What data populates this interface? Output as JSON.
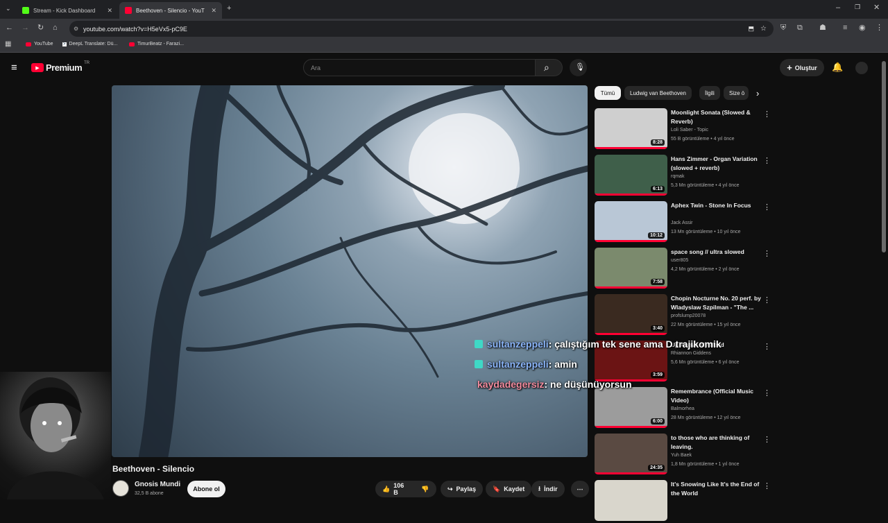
{
  "browser": {
    "tabs": [
      {
        "title": "Stream - Kick Dashboard",
        "favicon_color": "#53fc18"
      },
      {
        "title": "Beethoven - Silencio - YouT",
        "favicon_color": "#ff0033",
        "active": true
      }
    ],
    "url": "youtube.com/watch?v=H5eVx5-pC9E",
    "bookmarks": [
      "YouTube",
      "DeepL Translate: Dü...",
      "TimurBeatz - Farazi..."
    ]
  },
  "header": {
    "logo_text": "Premium",
    "logo_region": "TR",
    "search_placeholder": "Ara",
    "create_label": "Oluştur"
  },
  "video": {
    "title": "Beethoven - Silencio",
    "channel": "Gnosis Mundi",
    "subscribers": "32,5 B abone",
    "subscribe_label": "Abone ol",
    "likes": "106 B",
    "share_label": "Paylaş",
    "save_label": "Kaydet",
    "download_label": "İndir"
  },
  "chips": [
    "Tümü",
    "Ludwig van Beethoven",
    "İlgili",
    "Size ö"
  ],
  "recommendations": [
    {
      "title": "Moonlight Sonata (Slowed & Reverb)",
      "channel": "Loli Saber - Topic",
      "meta": "55 B görüntüleme • 4 yıl önce",
      "duration": "8:28",
      "thumb": "#cfcfcf"
    },
    {
      "title": "Hans Zimmer - Organ Variation (slowed + reverb)",
      "channel": "rqmak",
      "meta": "5,3 Mn görüntüleme • 4 yıl önce",
      "duration": "6:13",
      "thumb": "#3f5f4a"
    },
    {
      "title": "Aphex Twin - Stone In Focus",
      "channel": "Jack Assir",
      "meta": "13 Mn görüntüleme • 10 yıl önce",
      "duration": "10:12",
      "thumb": "#b9c7d6"
    },
    {
      "title": "space song // ultra slowed",
      "channel": "user805",
      "meta": "4,2 Mn görüntüleme • 2 yıl önce",
      "duration": "7:58",
      "thumb": "#7b8a6d"
    },
    {
      "title": "Chopin Nocturne No. 20 perf. by Wladyslaw Szpilman - \"The ...",
      "channel": "profslump20078",
      "meta": "22 Mn görüntüleme • 15 yıl önce",
      "duration": "3:40",
      "thumb": "#3a2a20"
    },
    {
      "title": "Up Above My Head",
      "channel": "Rhiannon Giddens",
      "meta": "5,6 Mn görüntüleme • 6 yıl önce",
      "duration": "3:59",
      "thumb": "#6b1414"
    },
    {
      "title": "Remembrance (Official Music Video)",
      "channel": "Balmorhea",
      "meta": "28 Mn görüntüleme • 12 yıl önce",
      "duration": "6:00",
      "thumb": "#9c9c9c"
    },
    {
      "title": "to those who are thinking of leaving.",
      "channel": "Yuh Baek",
      "meta": "1,8 Mn görüntüleme • 1 yıl önce",
      "duration": "24:35",
      "thumb": "#5a4a42"
    },
    {
      "title": "It's Snowing Like It's the End of the World",
      "channel": "",
      "meta": "",
      "duration": "",
      "thumb": "#d9d6cc"
    }
  ],
  "chat": [
    {
      "user": "sultanzeppeli",
      "message": ": çalıştığım tek sene ama D trajikomik",
      "badge": true
    },
    {
      "user": "sultanzeppeli",
      "message": ": amin",
      "badge": true
    },
    {
      "user": "kaydadegersiz",
      "message": ": ne düşünüyorsun",
      "badge": false
    }
  ]
}
